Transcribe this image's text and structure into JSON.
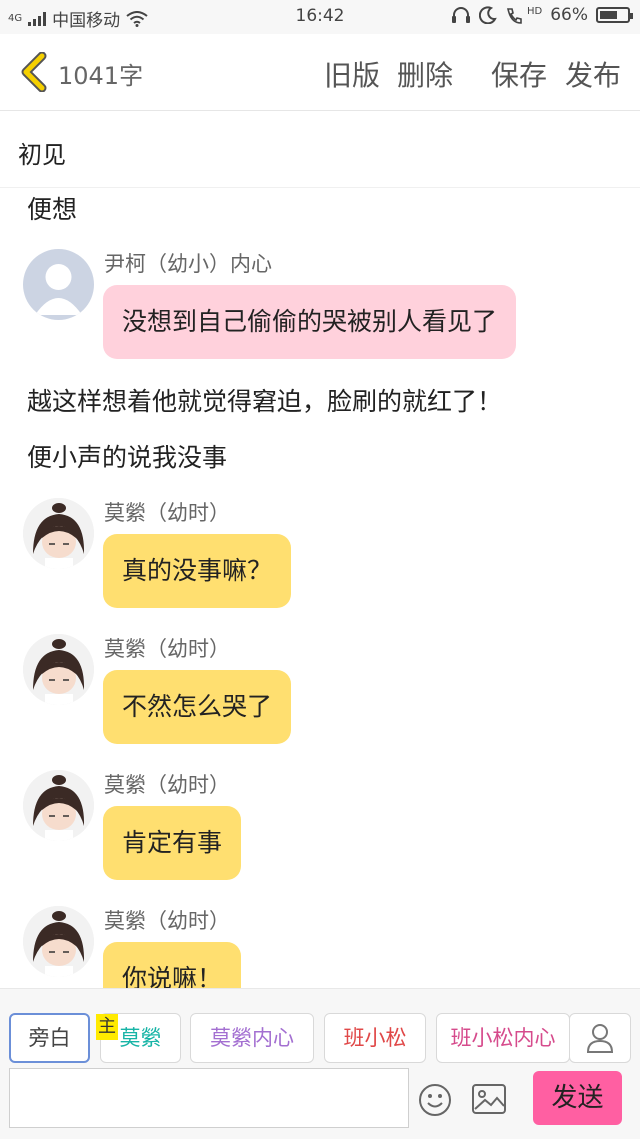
{
  "status_bar": {
    "network": "4G",
    "carrier": "中国移动",
    "time": "16:42",
    "hd_label": "HD",
    "battery": "66%",
    "battery_level": 0.66
  },
  "header": {
    "word_count": "1041字",
    "old_version": "旧版",
    "delete": "删除",
    "save": "保存",
    "publish": "发布"
  },
  "document": {
    "title": "初见"
  },
  "content": {
    "narration_1": "便想",
    "msg_1": {
      "speaker": "尹柯（幼小）内心",
      "text": "没想到自己偷偷的哭被别人看见了"
    },
    "narration_2": "越这样想着他就觉得窘迫，脸刷的就红了！",
    "narration_3": "便小声的说我没事",
    "msg_2": {
      "speaker": "莫縈（幼时）",
      "text": "真的没事嘛？"
    },
    "msg_3": {
      "speaker": "莫縈（幼时）",
      "text": "不然怎么哭了"
    },
    "msg_4": {
      "speaker": "莫縈（幼时）",
      "text": "肯定有事"
    },
    "msg_5": {
      "speaker": "莫縈（幼时）",
      "text": "你说嘛！"
    }
  },
  "roles": {
    "host_badge": "主",
    "items": [
      {
        "label": "旁白",
        "color": "#444444"
      },
      {
        "label": "莫縈",
        "color": "#17b4a6"
      },
      {
        "label": "莫縈内心",
        "color": "#a36fd1"
      },
      {
        "label": "班小松",
        "color": "#e04848"
      },
      {
        "label": "班小松内心",
        "color": "#d64b8c"
      }
    ]
  },
  "input": {
    "value": "",
    "send_label": "发送"
  },
  "colors": {
    "pink_bubble": "#ffd1dc",
    "yellow_bubble": "#ffdf70",
    "send_button": "#ff5fa2",
    "back_arrow": "#f5d000"
  }
}
